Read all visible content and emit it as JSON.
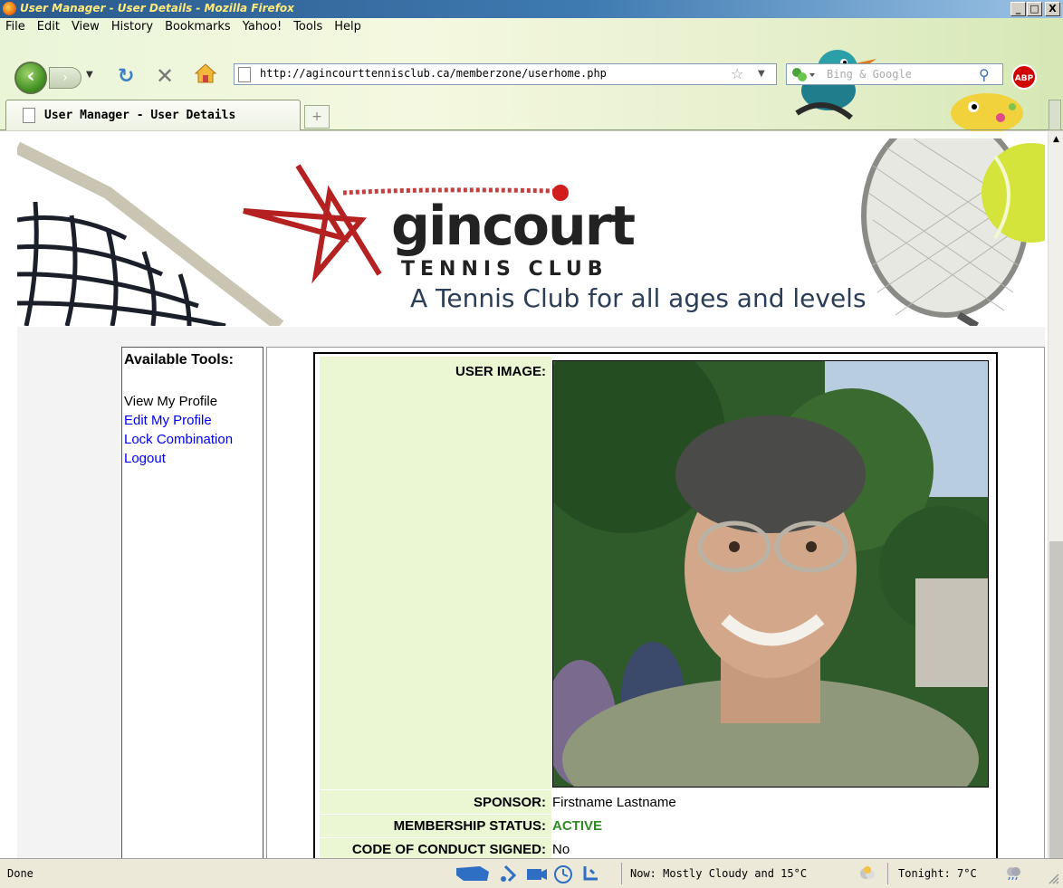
{
  "window": {
    "title": "User Manager - User Details - Mozilla Firefox",
    "min_label": "_",
    "max_label": "□",
    "close_label": "X"
  },
  "menu": {
    "items": [
      "File",
      "Edit",
      "View",
      "History",
      "Bookmarks",
      "Yahoo!",
      "Tools",
      "Help"
    ]
  },
  "nav": {
    "url": "http://agincourttennisclub.ca/memberzone/userhome.php",
    "search_placeholder": "Bing & Google",
    "abp_label": "ABP"
  },
  "tabs": {
    "active_label": "User Manager - User Details",
    "new_tab_label": "+"
  },
  "banner": {
    "brand_main": "gincourt",
    "brand_sub": "TENNIS CLUB",
    "tagline": "A Tennis Club for all ages and levels"
  },
  "sidebar": {
    "heading": "Available Tools:",
    "items": [
      {
        "label": "View My Profile",
        "link": false
      },
      {
        "label": "Edit My Profile",
        "link": true
      },
      {
        "label": "Lock Combination",
        "link": true
      },
      {
        "label": "Logout",
        "link": true
      }
    ]
  },
  "details": {
    "user_image_label": "USER IMAGE:",
    "sponsor_label": "SPONSOR:",
    "sponsor_value": "Firstname Lastname",
    "status_label": "MEMBERSHIP STATUS:",
    "status_value": "ACTIVE",
    "status_color": "#2e8b23",
    "conduct_label": "CODE OF CONDUCT SIGNED:",
    "conduct_value": "No"
  },
  "status": {
    "text": "Done",
    "weather_now": "Now: Mostly Cloudy and 15°C",
    "weather_tonight": "Tonight: 7°C"
  },
  "colors": {
    "label_bg": "#ebf7d2",
    "link": "#0000ee"
  }
}
